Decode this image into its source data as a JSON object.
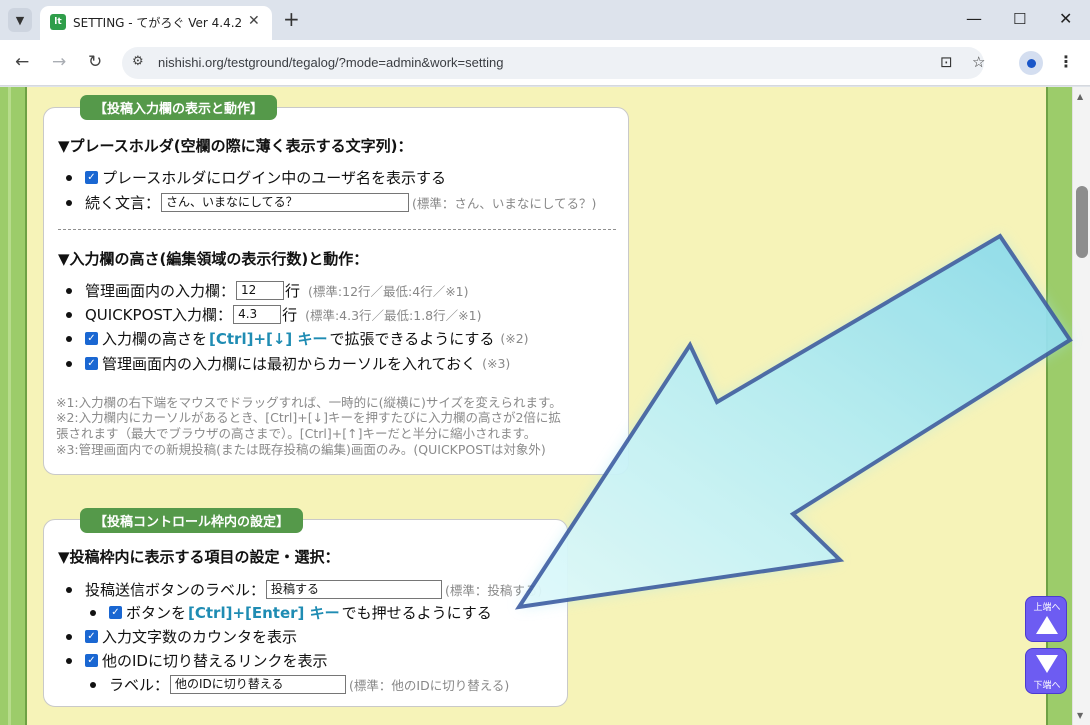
{
  "browser": {
    "tab_title": "SETTING - てがろぐ Ver 4.4.2",
    "favicon_text": "lt",
    "url": "nishishi.org/testground/tegalog/?mode=admin&work=setting",
    "icons": [
      "chevron-down-icon",
      "close-icon",
      "plus-icon",
      "minimize-icon",
      "maximize-icon",
      "window-close-icon",
      "back-icon",
      "forward-icon",
      "reload-icon",
      "site-info-icon",
      "screenshot-icon",
      "star-icon",
      "profile-icon",
      "more-menu-icon"
    ]
  },
  "panel1": {
    "label": "【投稿入力欄の表示と動作】",
    "placeholder_head": "▼プレースホルダ(空欄の際に薄く表示する文字列)：",
    "show_username": "プレースホルダにログイン中のユーザ名を表示する",
    "cont_label": "続く文言：",
    "cont_value": "さん、いまなにしてる？",
    "cont_note": "(標準：さん、いまなにしてる？)",
    "height_head": "▼入力欄の高さ(編集領域の表示行数)と動作：",
    "admin_label": "管理画面内の入力欄：",
    "admin_value": "12",
    "admin_unit": "行",
    "admin_note": "(標準:12行／最低:4行／※1)",
    "qp_label": "QUICKPOST入力欄：",
    "qp_value": "4.3",
    "qp_unit": "行",
    "qp_note": "(標準:4.3行／最低:1.8行／※1)",
    "expand_pre": "入力欄の高さを",
    "expand_key": "[Ctrl]+[↓] キー",
    "expand_post": "で拡張できるようにする",
    "expand_note": "(※2)",
    "cursor_text": "管理画面内の入力欄には最初からカーソルを入れておく",
    "cursor_note": "(※3)",
    "foot1": "※1:入力欄の右下端をマウスでドラッグすれば、一時的に(縦横に)サイズを変えられます。",
    "foot2": "※2:入力欄内にカーソルがあるとき、[Ctrl]+[↓]キーを押すたびに入力欄の高さが2倍に拡",
    "foot3": "張されます（最大でブラウザの高さまで）。[Ctrl]+[↑]キーだと半分に縮小されます。",
    "foot4": "※3:管理画面内での新規投稿(または既存投稿の編集)画面のみ。(QUICKPOSTは対象外)"
  },
  "panel2": {
    "label": "【投稿コントロール枠内の設定】",
    "head": "▼投稿枠内に表示する項目の設定・選択：",
    "send_label": "投稿送信ボタンのラベル：",
    "send_value": "投稿する",
    "send_note": "(標準：投稿する)",
    "enter_pre": "ボタンを",
    "enter_key": "[Ctrl]+[Enter] キー",
    "enter_post": "でも押せるようにする",
    "counter": "入力文字数のカウンタを表示",
    "switch": "他のIDに切り替えるリンクを表示",
    "switch_label": "ラベル：",
    "switch_value": "他のIDに切り替える",
    "switch_note": "(標準：他のIDに切り替える)"
  },
  "jump": {
    "top_label": "上端へ",
    "bottom_label": "下端へ"
  },
  "colors": {
    "page_bg": "#f6f3b8",
    "green_border": "#9ccc6a",
    "label_bg": "#55994a",
    "key_color": "#1f8cb3",
    "checkbox": "#1a67d2",
    "jump_button": "#6d5cf2"
  }
}
